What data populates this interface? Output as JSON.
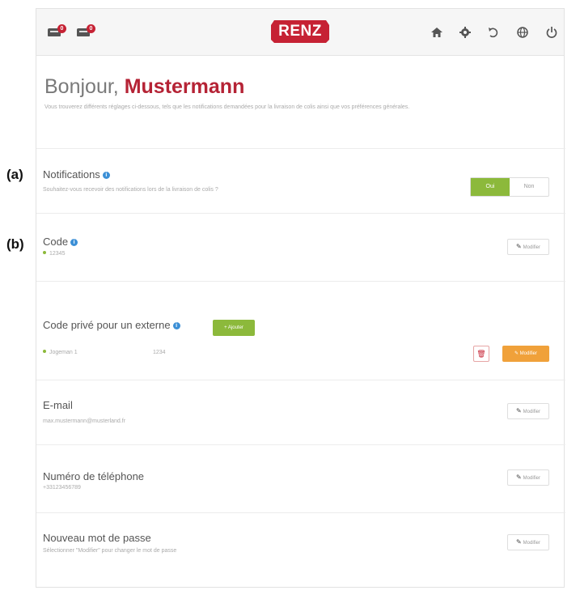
{
  "annotations": {
    "a": "(a)",
    "b": "(b)"
  },
  "header": {
    "mailbox_badges": [
      "0",
      "0"
    ],
    "logo_text": "RENZ",
    "icons": [
      "home-icon",
      "settings-icon",
      "undo-icon",
      "globe-icon",
      "power-icon"
    ]
  },
  "greeting": {
    "hello": "Bonjour,",
    "name": "Mustermann",
    "intro": "Vous trouverez différents réglages ci-dessous, tels que les notifications demandées pour la livraison de colis ainsi que vos préférences générales."
  },
  "notifications": {
    "title": "Notifications",
    "subtitle": "Souhaitez-vous recevoir des notifications lors de la livraison de colis ?",
    "toggle_on": "Oui",
    "toggle_off": "Non"
  },
  "code": {
    "title": "Code",
    "value": "12345",
    "edit_label": "Modifier"
  },
  "external_code": {
    "title": "Code privé pour un externe",
    "add_label": "Ajouter",
    "entry_name": "Jogeman 1",
    "entry_code": "1234",
    "edit_label": "Modifier"
  },
  "email": {
    "title": "E-mail",
    "value": "max.mustermann@musterland.fr",
    "edit_label": "Modifier"
  },
  "phone": {
    "title": "Numéro de téléphone",
    "value": "+33123456789",
    "edit_label": "Modifier"
  },
  "password": {
    "title": "Nouveau mot de passe",
    "subtitle": "Sélectionner \"Modifier\" pour changer le mot de passe",
    "edit_label": "Modifier"
  },
  "colors": {
    "brand": "#c62234",
    "accent_green": "#8cb93b",
    "accent_orange": "#f0a13a",
    "info_blue": "#3b8fd6"
  }
}
